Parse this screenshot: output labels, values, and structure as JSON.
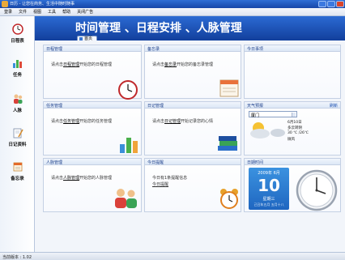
{
  "window": {
    "title": "日历 - 让您在商务、生活中随时随事"
  },
  "menu": [
    "登录",
    "文件",
    "视图",
    "工具",
    "帮助",
    "关闭广告"
  ],
  "sidebar": [
    {
      "label": "日程表",
      "icon": "clock-icon"
    },
    {
      "label": "任务",
      "icon": "bar-chart-icon"
    },
    {
      "label": "人脉",
      "icon": "people-icon"
    },
    {
      "label": "日记资料",
      "icon": "diary-pen-icon"
    },
    {
      "label": "备忘录",
      "icon": "memo-icon"
    }
  ],
  "header": {
    "headline": "时间管理 、日程安排 、人脉管理",
    "tab_label": "首页"
  },
  "cards": {
    "schedule": {
      "title": "日程管理",
      "prefix": "请点击",
      "link": "日程管理",
      "suffix": "开始您的日程管理"
    },
    "memo": {
      "title": "备忘录",
      "prefix": "请点击",
      "link": "备忘录",
      "suffix": "开始您的备忘录管理"
    },
    "today_events": {
      "title": "今日事项"
    },
    "tasks": {
      "title": "任务管理",
      "prefix": "请点击",
      "link": "任务管理",
      "suffix": "开始您的任务管理"
    },
    "diary": {
      "title": "日记管理",
      "prefix": "请点击",
      "link": "日记管理",
      "suffix": "开始记录您的心情"
    },
    "weather": {
      "title": "天气预报",
      "more": "刷新",
      "city": "厦门",
      "date": "6月10日",
      "condition": "多云转阴",
      "temp": "30 ℃ /26℃",
      "wind": "微风"
    },
    "contacts": {
      "title": "人脉管理",
      "prefix": "请点击",
      "link": "人脉管理",
      "suffix": "开始您的人脉管理"
    },
    "reminder": {
      "title": "今日提醒",
      "line1": "今日有1条提醒信息",
      "link": "今日提醒"
    },
    "datetime": {
      "title": "日期时间",
      "year_month": "2009年 6月",
      "day": "10",
      "weekday": "星期三",
      "lunar": "己丑年五月 五月十八"
    }
  },
  "status": {
    "version_text": "当前版本 : 1.02"
  },
  "colors": {
    "header_blue": "#1f56c0",
    "calendar_blue": "#2a86d8"
  }
}
